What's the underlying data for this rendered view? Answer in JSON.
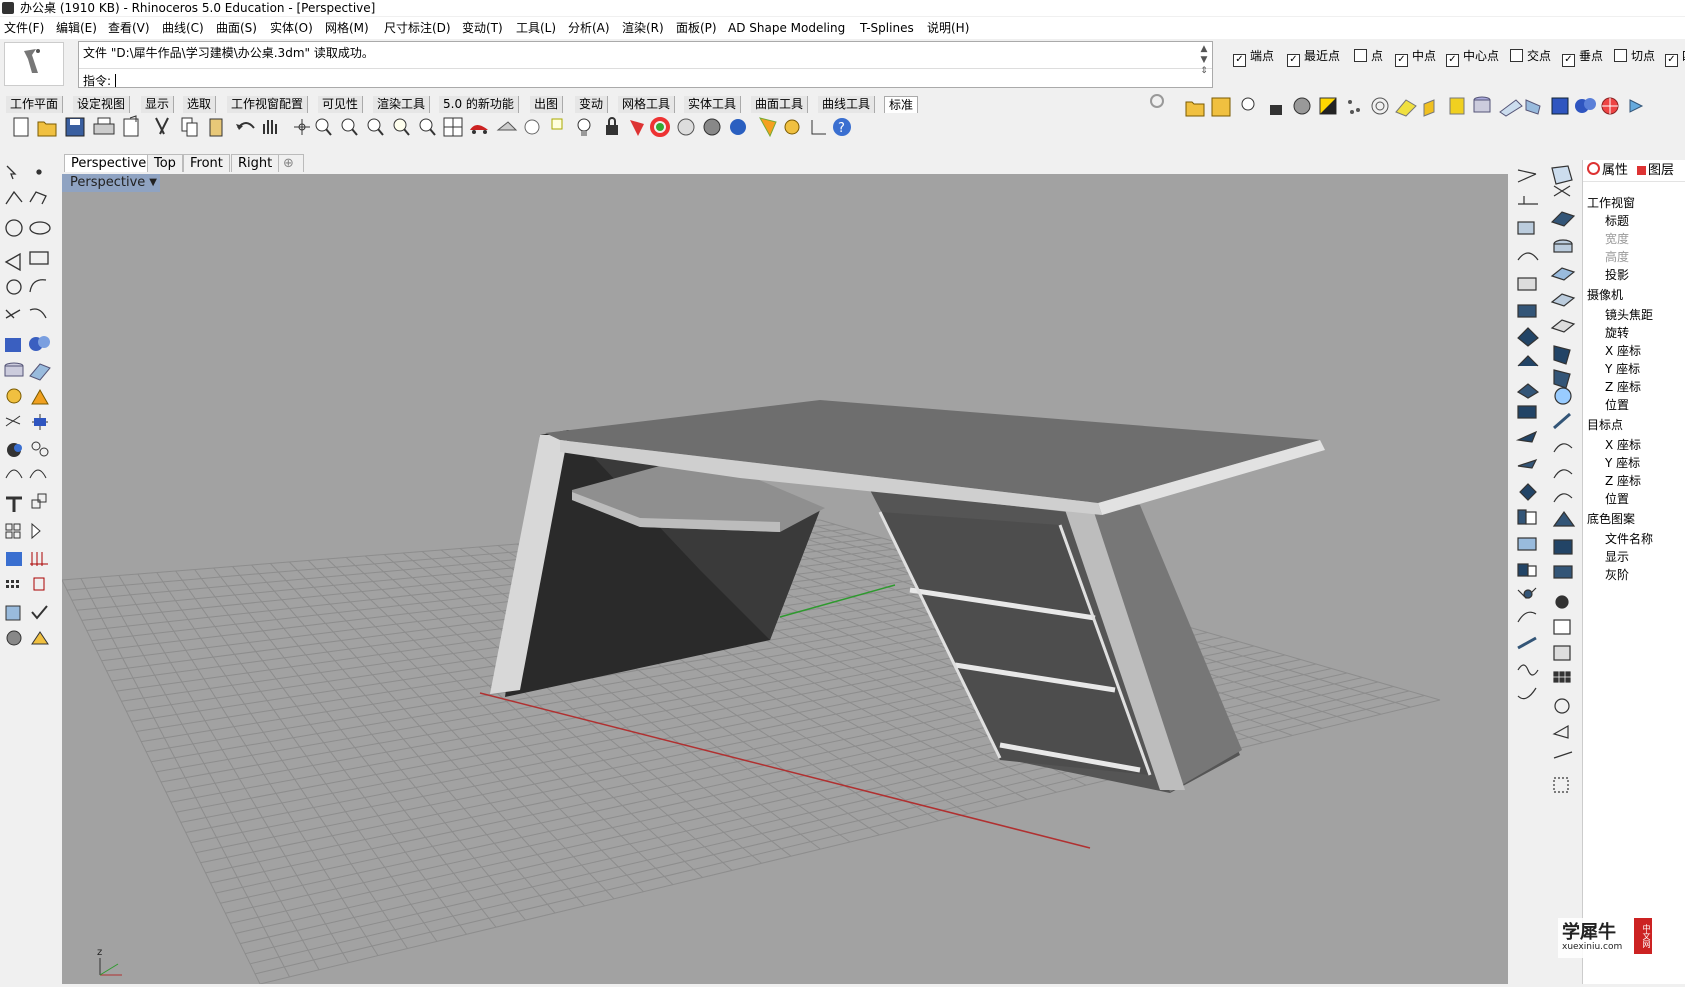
{
  "window": {
    "title": "办公桌 (1910 KB) - Rhinoceros 5.0 Education - [Perspective]"
  },
  "menu": [
    "文件(F)",
    "编辑(E)",
    "查看(V)",
    "曲线(C)",
    "曲面(S)",
    "实体(O)",
    "网格(M)",
    "尺寸标注(D)",
    "变动(T)",
    "工具(L)",
    "分析(A)",
    "渲染(R)",
    "面板(P)",
    "AD Shape Modeling",
    "T-Splines",
    "说明(H)"
  ],
  "command": {
    "history": "文件 \"D:\\犀牛作品\\学习建模\\办公桌.3dm\" 读取成功。",
    "prompt": "指令:",
    "value": ""
  },
  "osnap": [
    {
      "label": "端点",
      "checked": true
    },
    {
      "label": "最近点",
      "checked": true
    },
    {
      "label": "点",
      "checked": false
    },
    {
      "label": "中点",
      "checked": true
    },
    {
      "label": "中心点",
      "checked": true
    },
    {
      "label": "交点",
      "checked": false
    },
    {
      "label": "垂点",
      "checked": true
    },
    {
      "label": "切点",
      "checked": false
    },
    {
      "label": "四",
      "checked": true
    }
  ],
  "toolbar_tabs": [
    "工作平面",
    "设定视图",
    "显示",
    "选取",
    "工作视窗配置",
    "可见性",
    "渲染工具",
    "5.0 的新功能",
    "出图",
    "变动",
    "网格工具",
    "实体工具",
    "曲面工具",
    "曲线工具",
    "标准"
  ],
  "active_toolbar_tab": "标准",
  "viewport_tabs": [
    "Perspective",
    "Top",
    "Front",
    "Right"
  ],
  "viewport": {
    "name": "Perspective",
    "axis_label": "z"
  },
  "properties": {
    "tab_properties": "属性",
    "tab_layers": "图层",
    "section_viewport": "工作视窗",
    "title": "标题",
    "width": "宽度",
    "height": "高度",
    "projection": "投影",
    "section_camera": "摄像机",
    "lens": "镜头焦距",
    "rotation": "旋转",
    "x": "X 座标",
    "y": "Y 座标",
    "z": "Z 座标",
    "location": "位置",
    "section_target": "目标点",
    "tx": "X 座标",
    "ty": "Y 座标",
    "tz": "Z 座标",
    "tlocation": "位置",
    "section_wallpaper": "底色图案",
    "filename": "文件名称",
    "show": "显示",
    "grayscale": "灰阶"
  },
  "watermark": {
    "brand": "学犀牛",
    "url": "xuexiniu.com",
    "badge": "中文网"
  },
  "colors": {
    "viewport_bg": "#a2a2a2",
    "grid": "#8d8d8d",
    "x_axis": "#b03030",
    "y_axis": "#2e9a2e",
    "active_vp_title": "#8fa3c2"
  }
}
